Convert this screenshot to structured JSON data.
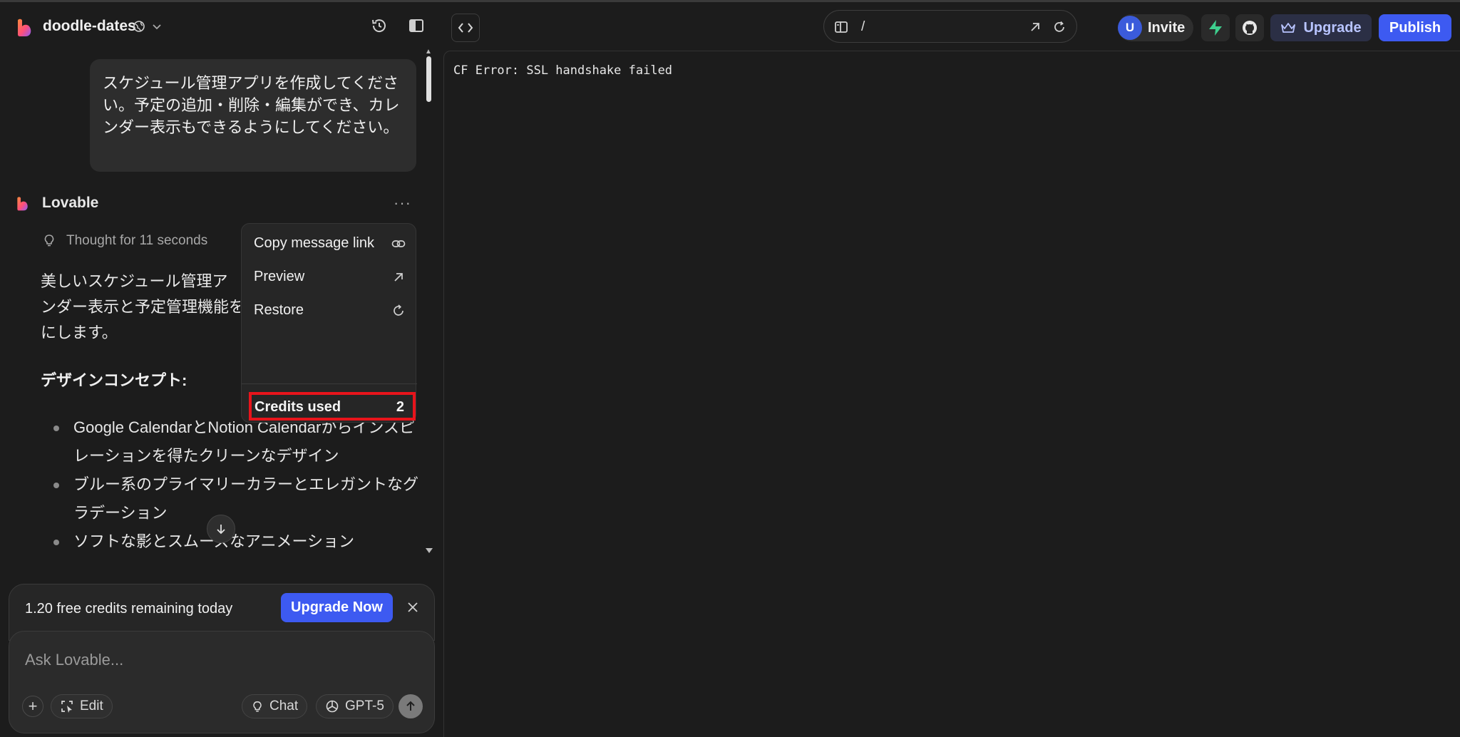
{
  "project": {
    "name": "doodle-dates"
  },
  "topbar": {
    "url_path": "/",
    "avatar_initial": "U",
    "invite_label": "Invite",
    "upgrade_label": "Upgrade",
    "publish_label": "Publish"
  },
  "chat": {
    "user_message": "スケジュール管理アプリを作成してください。予定の追加・削除・編集ができ、カレンダー表示もできるようにしてください。",
    "assistant_name": "Lovable",
    "thought": "Thought for 11 seconds",
    "reply_lines": [
      "美しいスケジュール管理ア",
      "ンダー表示と予定管理機能を",
      "にします。"
    ],
    "design_heading": "デザインコンセプト:",
    "bullets": [
      "Google CalendarとNotion Calendarからインスピレーションを得たクリーンなデザイン",
      "ブルー系のプライマリーカラーとエレガントなグラデーション",
      "ソフトな影とスムーズなアニメーション"
    ]
  },
  "context_menu": {
    "items": [
      {
        "label": "Copy message link",
        "icon": "link-icon"
      },
      {
        "label": "Preview",
        "icon": "arrow-up-right-icon"
      },
      {
        "label": "Restore",
        "icon": "restore-icon"
      }
    ],
    "credits_label": "Credits used",
    "credits_value": "2"
  },
  "composer": {
    "credits_text": "1.20 free credits remaining today",
    "upgrade_now_label": "Upgrade Now",
    "placeholder": "Ask Lovable...",
    "edit_label": "Edit",
    "chat_label": "Chat",
    "model_label": "GPT-5"
  },
  "preview": {
    "error_text": "CF Error: SSL handshake failed"
  },
  "colors": {
    "background": "#1c1c1c",
    "accent": "#3d5af1",
    "highlight_box": "#e8141b"
  }
}
